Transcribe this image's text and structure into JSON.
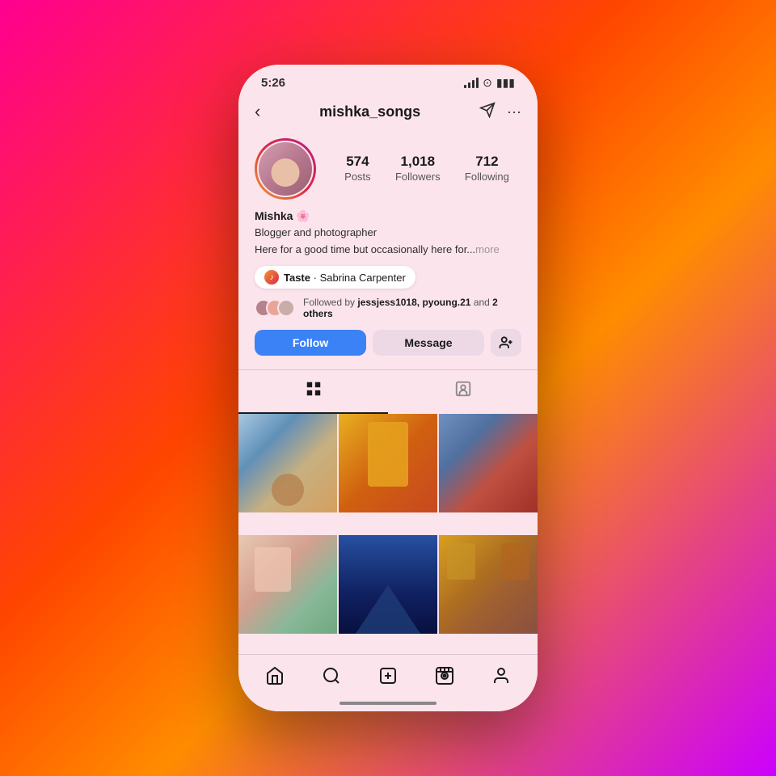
{
  "background": {
    "gradient": "linear-gradient(135deg, #ff0090 0%, #ff4500 40%, #ff8c00 60%, #cc00ff 100%)"
  },
  "status_bar": {
    "time": "5:26"
  },
  "nav": {
    "username": "mishka_songs",
    "back_label": "‹",
    "direct_icon": "direct",
    "more_icon": "more"
  },
  "profile": {
    "name": "Mishka 🌸",
    "bio_line1": "Blogger and photographer",
    "bio_line2": "Here for a good time but occasionally here for...",
    "bio_more": "more",
    "stats": {
      "posts": {
        "value": "574",
        "label": "Posts"
      },
      "followers": {
        "value": "1,018",
        "label": "Followers"
      },
      "following": {
        "value": "712",
        "label": "Following"
      }
    }
  },
  "music": {
    "song": "Taste",
    "artist": "Sabrina Carpenter",
    "separator": "·"
  },
  "mutual_followers": {
    "text_prefix": "Followed by ",
    "users": "jessjess1018, pyoung.21",
    "text_suffix": " and ",
    "count": "2 others"
  },
  "actions": {
    "follow_label": "Follow",
    "message_label": "Message",
    "add_friend_label": "+"
  },
  "tabs": {
    "grid_tab": "grid",
    "tagged_tab": "tagged"
  },
  "bottom_nav": {
    "items": [
      {
        "name": "home",
        "icon": "⌂"
      },
      {
        "name": "search",
        "icon": "🔍"
      },
      {
        "name": "add",
        "icon": "⊕"
      },
      {
        "name": "reels",
        "icon": "▶"
      },
      {
        "name": "profile",
        "icon": "○"
      }
    ]
  },
  "photos": [
    {
      "id": 1,
      "css_class": "photo-1"
    },
    {
      "id": 2,
      "css_class": "photo-2"
    },
    {
      "id": 3,
      "css_class": "photo-3"
    },
    {
      "id": 4,
      "css_class": "photo-4"
    },
    {
      "id": 5,
      "css_class": "photo-5"
    },
    {
      "id": 6,
      "css_class": "photo-6"
    }
  ]
}
